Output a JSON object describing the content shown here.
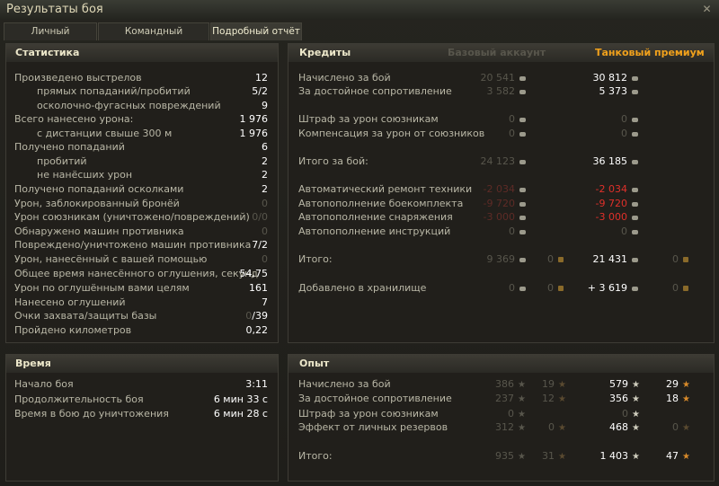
{
  "window": {
    "title": "Результаты боя",
    "close_glyph": "✕"
  },
  "tabs": [
    {
      "label": "Личный результат",
      "active": false
    },
    {
      "label": "Командный результат",
      "active": false
    },
    {
      "label": "Подробный отчёт",
      "active": true
    }
  ],
  "stats": {
    "header": "Статистика",
    "rows": [
      {
        "label": "Произведено выстрелов",
        "value": "12"
      },
      {
        "label": "прямых попаданий/пробитий",
        "value": "5/2"
      },
      {
        "label": "осколочно-фугасных повреждений",
        "value": "9"
      },
      {
        "label": "Всего нанесено урона:",
        "value": "1 976"
      },
      {
        "label": "с дистанции свыше 300 м",
        "value": "1 976"
      },
      {
        "label": "Получено попаданий",
        "value": "6"
      },
      {
        "label": "пробитий",
        "value": "2"
      },
      {
        "label": "не нанёсших урон",
        "value": "2"
      },
      {
        "label": "Получено попаданий осколками",
        "value": "2"
      },
      {
        "label": "Урон, заблокированный бронёй",
        "value": "0"
      },
      {
        "label": "Урон союзникам (уничтожено/повреждений)",
        "value": "0/0"
      },
      {
        "label": "Обнаружено машин противника",
        "value": "0"
      },
      {
        "label": "Повреждено/уничтожено машин противника",
        "value": "7/2"
      },
      {
        "label": "Урон, нанесённый с вашей помощью",
        "value": "0"
      },
      {
        "label": "Общее время нанесённого оглушения, секунд",
        "value": "54,75"
      },
      {
        "label": "Урон по оглушённым вами целям",
        "value": "161"
      },
      {
        "label": "Нанесено оглушений",
        "value": "7"
      },
      {
        "label": "Очки захвата/защиты базы",
        "value_dim": "0",
        "value": "/39"
      },
      {
        "label": "Пройдено километров",
        "value": "0,22"
      }
    ]
  },
  "time": {
    "header": "Время",
    "rows": [
      {
        "label": "Начало боя",
        "value": "3:11"
      },
      {
        "label": "Продолжительность боя",
        "value": "6 мин 33 с"
      },
      {
        "label": "Время в бою до уничтожения",
        "value": "6 мин 28 с"
      }
    ]
  },
  "credits": {
    "header": "Кредиты",
    "col_basic": "Базовый аккаунт",
    "col_premium": "Танковый премиум",
    "rows": [
      {
        "label": "Начислено за бой",
        "basic": "20 541",
        "premium": "30 812"
      },
      {
        "label": "За достойное сопротивление",
        "basic": "3 582",
        "premium": "5 373"
      },
      {
        "label": "Штраф за урон союзникам",
        "basic": "0",
        "premium": "0"
      },
      {
        "label": "Компенсация за урон от союзников",
        "basic": "0",
        "premium": "0"
      },
      {
        "label": "Итого за бой:",
        "basic": "24 123",
        "premium": "36 185"
      },
      {
        "label": "Автоматический ремонт техники",
        "basic": "-2 034",
        "premium": "-2 034"
      },
      {
        "label": "Автопополнение боекомплекта",
        "basic": "-9 720",
        "premium": "-9 720"
      },
      {
        "label": "Автопополнение снаряжения",
        "basic": "-3 000",
        "premium": "-3 000"
      },
      {
        "label": "Автопополнение инструкций",
        "basic": "0",
        "premium": "0"
      },
      {
        "label": "Итого:",
        "basic": "9 369",
        "basic_gold": "0",
        "premium": "21 431",
        "premium_gold": "0"
      },
      {
        "label": "Добавлено в хранилище",
        "basic": "0",
        "basic_gold": "0",
        "premium": "+ 3 619",
        "premium_gold": "0"
      }
    ]
  },
  "xp": {
    "header": "Опыт",
    "rows": [
      {
        "label": "Начислено за бой",
        "basic": "386",
        "basic_free": "19",
        "premium": "579",
        "premium_free": "29"
      },
      {
        "label": "За достойное сопротивление",
        "basic": "237",
        "basic_free": "12",
        "premium": "356",
        "premium_free": "18"
      },
      {
        "label": "Штраф за урон союзникам",
        "basic": "0",
        "premium": "0"
      },
      {
        "label": "Эффект от личных резервов",
        "basic": "312",
        "basic_free": "0",
        "premium": "468",
        "premium_free": "0"
      },
      {
        "label": "Итого:",
        "basic": "935",
        "basic_free": "31",
        "premium": "1 403",
        "premium_free": "47"
      }
    ]
  },
  "icons": {
    "star": "★",
    "credit": "credit-icon",
    "gold": "gold-icon"
  }
}
